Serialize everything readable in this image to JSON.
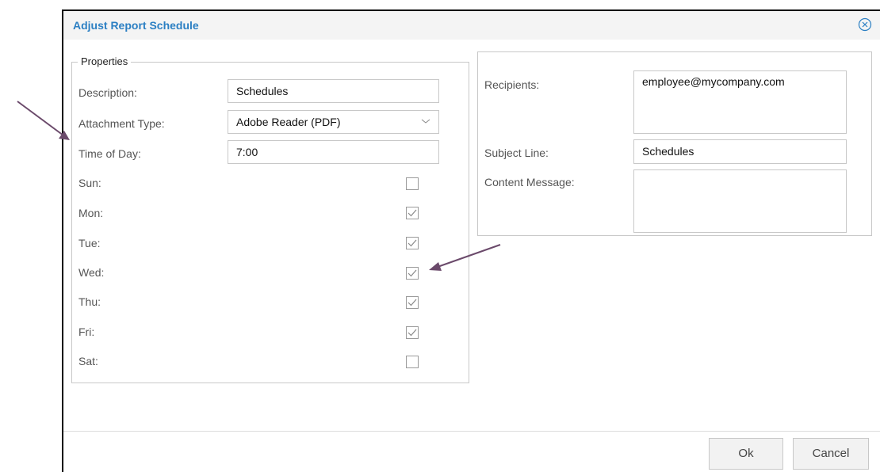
{
  "dialog": {
    "title": "Adjust Report Schedule",
    "close_icon": "close-circle-icon"
  },
  "properties": {
    "legend": "Properties",
    "description": {
      "label": "Description:",
      "value": "Schedules"
    },
    "attachment_type": {
      "label": "Attachment Type:",
      "value": "Adobe Reader (PDF)"
    },
    "time_of_day": {
      "label": "Time of Day:",
      "value": "7:00"
    },
    "days": [
      {
        "label": "Sun:",
        "checked": false
      },
      {
        "label": "Mon:",
        "checked": true
      },
      {
        "label": "Tue:",
        "checked": true
      },
      {
        "label": "Wed:",
        "checked": true
      },
      {
        "label": "Thu:",
        "checked": true
      },
      {
        "label": "Fri:",
        "checked": true
      },
      {
        "label": "Sat:",
        "checked": false
      }
    ]
  },
  "email": {
    "recipients": {
      "label": "Recipients:",
      "value": "employee@mycompany.com"
    },
    "subject": {
      "label": "Subject Line:",
      "value": "Schedules"
    },
    "content": {
      "label": "Content Message:",
      "value": ""
    }
  },
  "buttons": {
    "ok": "Ok",
    "cancel": "Cancel"
  },
  "colors": {
    "title": "#2b7fc3",
    "annotation_arrow": "#6b4a6b",
    "border": "#c8c8c8"
  }
}
